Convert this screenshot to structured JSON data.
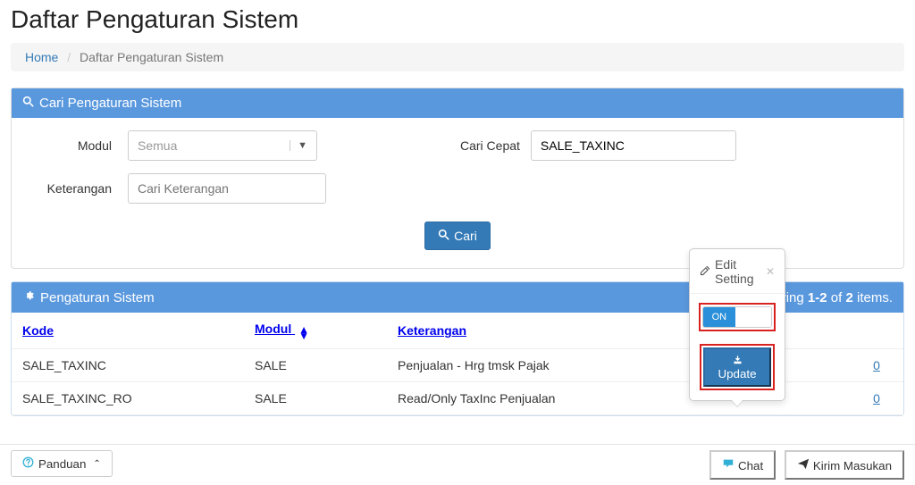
{
  "page": {
    "title": "Daftar Pengaturan Sistem"
  },
  "breadcrumb": {
    "home": "Home",
    "current": "Daftar Pengaturan Sistem"
  },
  "search_panel": {
    "title": "Cari Pengaturan Sistem"
  },
  "form": {
    "modul_label": "Modul",
    "modul_selected": "Semua",
    "cari_cepat_label": "Cari Cepat",
    "cari_cepat_value": "SALE_TAXINC",
    "keterangan_label": "Keterangan",
    "keterangan_placeholder": "Cari Keterangan",
    "search_btn": "Cari"
  },
  "table_panel": {
    "title": "Pengaturan Sistem",
    "pager_prefix": "wing ",
    "pager_bold1": "1-2",
    "pager_mid": " of ",
    "pager_bold2": "2",
    "pager_suffix": " items."
  },
  "columns": {
    "kode": "Kode",
    "modul": "Modul",
    "keterangan": "Keterangan"
  },
  "rows": [
    {
      "kode": "SALE_TAXINC",
      "modul": "SALE",
      "keterangan": "Penjualan - Hrg tmsk Pajak",
      "nilai": "0"
    },
    {
      "kode": "SALE_TAXINC_RO",
      "modul": "SALE",
      "keterangan": "Read/Only TaxInc Penjualan",
      "nilai": "0"
    }
  ],
  "popover": {
    "title": "Edit Setting",
    "toggle_on": "ON",
    "update_label": "Update"
  },
  "bottom": {
    "panduan": "Panduan",
    "chat": "Chat",
    "kirim": "Kirim Masukan"
  }
}
